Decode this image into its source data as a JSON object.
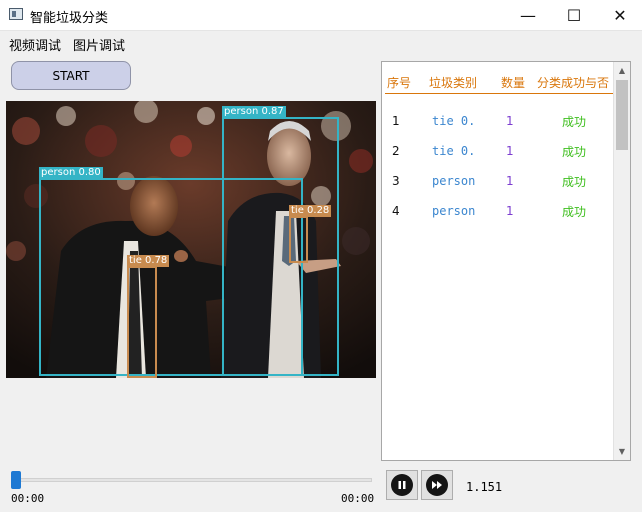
{
  "window": {
    "title": "智能垃圾分类",
    "minimize_glyph": "—",
    "maximize_glyph": "☐",
    "close_glyph": "✕"
  },
  "menu": {
    "items": [
      "视频调试",
      "图片调试"
    ]
  },
  "toolbar": {
    "start_label": "START"
  },
  "video": {
    "detections": [
      {
        "label": "person 0.87",
        "kind": "person"
      },
      {
        "label": "person 0.80",
        "kind": "person"
      },
      {
        "label": "tie 0.28",
        "kind": "tie"
      },
      {
        "label": "tie 0.78",
        "kind": "tie"
      }
    ],
    "box_colors": {
      "person": "#34b4c6",
      "tie": "#c88b4f"
    }
  },
  "results_table": {
    "headers": [
      "序号",
      "垃圾类别",
      "数量",
      "分类成功与否"
    ],
    "rows": [
      {
        "seq": "1",
        "category": "tie 0.",
        "count": "1",
        "result": "成功"
      },
      {
        "seq": "2",
        "category": "tie 0.",
        "count": "1",
        "result": "成功"
      },
      {
        "seq": "3",
        "category": "person",
        "count": "1",
        "result": "成功"
      },
      {
        "seq": "4",
        "category": "person",
        "count": "1",
        "result": "成功"
      }
    ],
    "colors": {
      "header": "#d9760b",
      "category": "#3b86cf",
      "count": "#7d3ed0",
      "result": "#3fbf1f"
    }
  },
  "playback": {
    "current_time": "00:00",
    "end_time": "00:00",
    "position_fraction": 0.0,
    "speed": "1.151"
  },
  "icons": {
    "pause": "pause-icon",
    "fast_forward": "fast-forward-icon"
  }
}
